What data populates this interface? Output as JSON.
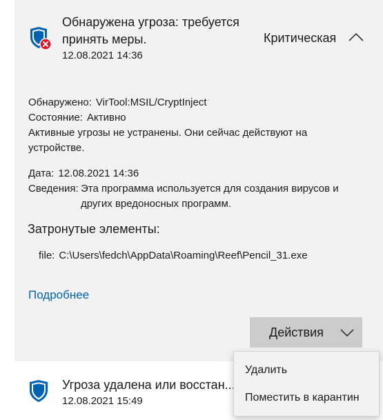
{
  "threat": {
    "title": "Обнаружена угроза: требуется принять меры.",
    "date": "12.08.2021 14:36",
    "severity": "Критическая",
    "icon": "shield-error-icon"
  },
  "details": {
    "detected_label": "Обнаружено:",
    "detected_value": "VirTool:MSIL/CryptInject",
    "status_label": "Состояние:",
    "status_value": "Активно",
    "active_note": "Активные угрозы не устранены. Они сейчас действуют на устройстве.",
    "date_label": "Дата:",
    "date_value": "12.08.2021 14:36",
    "info_label": "Сведения:",
    "info_value": "Эта программа используется для создания вирусов и других вредоносных программ."
  },
  "affected": {
    "header": "Затронутые элементы:",
    "file_label": "file:",
    "file_path": "C:\\Users\\fedch\\AppData\\Roaming\\Reef\\Pencil_31.exe"
  },
  "more_link": "Подробнее",
  "actions": {
    "label": "Действия",
    "menu": [
      "Удалить",
      "Поместить в карантин"
    ]
  },
  "second_threat": {
    "title": "Угроза удалена или восстан...",
    "date": "12.08.2021 15:49"
  },
  "colors": {
    "accent": "#0063b1",
    "error": "#e81123",
    "card_bg": "#f2f2f2",
    "button_bg": "#cccccc"
  }
}
